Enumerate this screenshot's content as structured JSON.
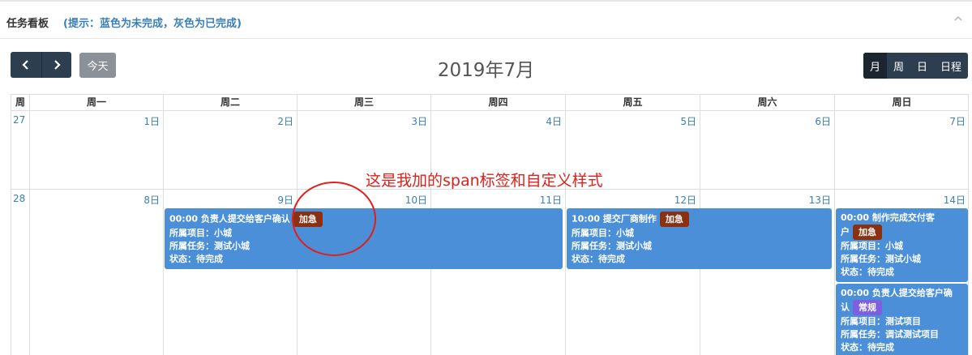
{
  "panel": {
    "title": "任务看板",
    "hint": "(提示：蓝色为未完成，灰色为已完成)"
  },
  "toolbar": {
    "prev_icon": "chevron-left-icon",
    "next_icon": "chevron-right-icon",
    "today_label": "今天",
    "title": "2019年7月",
    "views": [
      "月",
      "周",
      "日",
      "日程"
    ],
    "active_view": "月"
  },
  "calendar": {
    "week_col_label": "周",
    "weekdays": [
      "周一",
      "周二",
      "周三",
      "周四",
      "周五",
      "周六",
      "周日"
    ],
    "weeks": [
      {
        "week": "27",
        "days": [
          "1日",
          "2日",
          "3日",
          "4日",
          "5日",
          "6日",
          "7日"
        ]
      },
      {
        "week": "28",
        "days": [
          "8日",
          "9日",
          "10日",
          "11日",
          "12日",
          "13日",
          "14日"
        ]
      }
    ]
  },
  "events": [
    {
      "title": "00:00 负责人提交给客户确认",
      "badge": "加急",
      "project": "所属项目：小城",
      "task": "所属任务：测试小城",
      "status": "状态：待完成"
    },
    {
      "title": "10:00 提交厂商制作",
      "badge": "加急",
      "project": "所属项目：小城",
      "task": "所属任务：测试小城",
      "status": "状态：待完成"
    },
    {
      "title_line1": "00:00 制作完成交付客",
      "title_line2": "户",
      "badge": "加急",
      "project": "所属项目：小城",
      "task": "所属任务：测试小城",
      "status": "状态：待完成"
    },
    {
      "title_line1": "00:00 负责人提交给客户确",
      "title_line2": "认",
      "badge": "常规",
      "project": "所属项目：测试项目",
      "task": "所属任务：调试测试项目",
      "status": "状态：待完成"
    }
  ],
  "annotation": {
    "text": "这是我加的span标签和自定义样式",
    "color": "#e0201a"
  },
  "colors": {
    "event_blue": "#4a8fd8",
    "badge_urgent": "#8b3010",
    "badge_normal": "#7d5fe0",
    "nav_dark": "#2c3e50",
    "link_blue": "#3a7fb6"
  }
}
